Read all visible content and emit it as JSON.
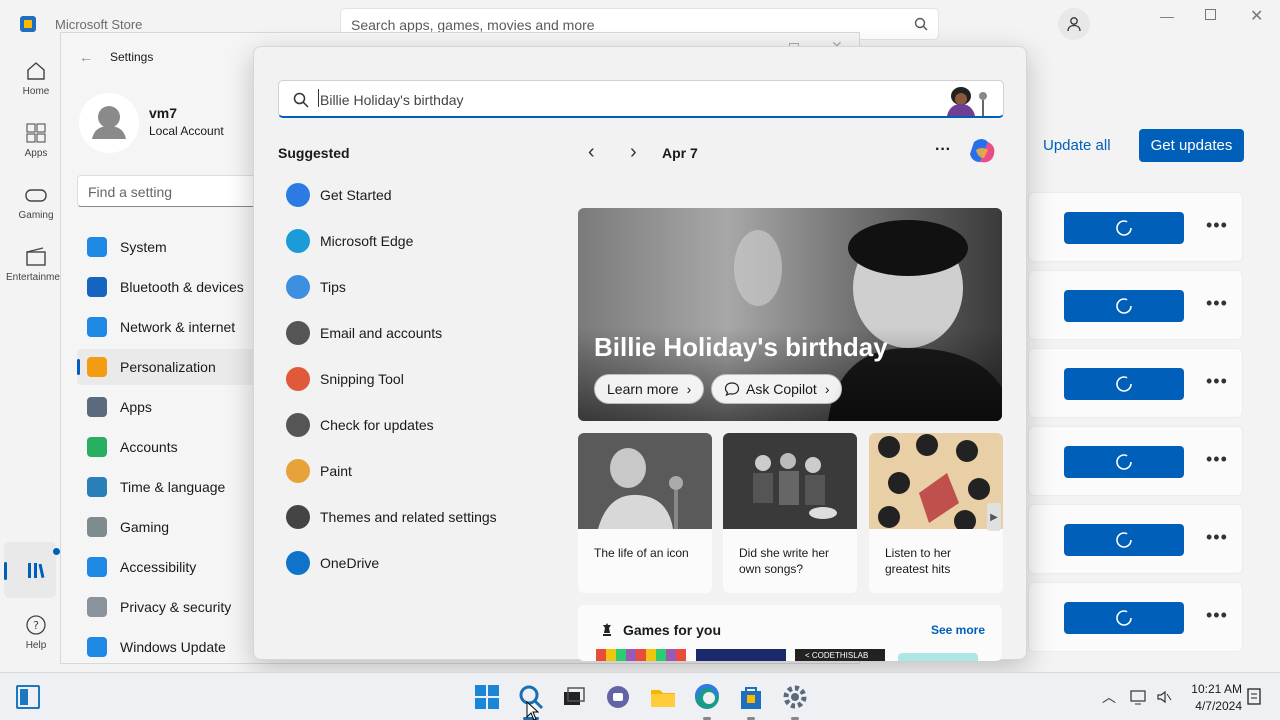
{
  "store": {
    "app_title": "Microsoft Store",
    "search_placeholder": "Search apps, games, movies and more",
    "nav": [
      {
        "label": "Home",
        "icon": "home-icon"
      },
      {
        "label": "Apps",
        "icon": "apps-icon"
      },
      {
        "label": "Gaming",
        "icon": "gaming-icon"
      },
      {
        "label": "Entertainment",
        "icon": "entertainment-icon"
      },
      {
        "label": "Help",
        "icon": "help-icon"
      }
    ],
    "update_all_label": "Update all",
    "get_updates_label": "Get updates",
    "rows_count": 6
  },
  "settings": {
    "title": "Settings",
    "user_name": "vm7",
    "account_type": "Local Account",
    "find_placeholder": "Find a setting",
    "items": [
      {
        "label": "System",
        "color": "#1e88e5"
      },
      {
        "label": "Bluetooth & devices",
        "color": "#1565c0"
      },
      {
        "label": "Network & internet",
        "color": "#1e88e5"
      },
      {
        "label": "Personalization",
        "color": "#f39c12"
      },
      {
        "label": "Apps",
        "color": "#5b6b7d"
      },
      {
        "label": "Accounts",
        "color": "#27ae60"
      },
      {
        "label": "Time & language",
        "color": "#2980b9"
      },
      {
        "label": "Gaming",
        "color": "#7f8c8d"
      },
      {
        "label": "Accessibility",
        "color": "#1e88e5"
      },
      {
        "label": "Privacy & security",
        "color": "#8a939c"
      },
      {
        "label": "Windows Update",
        "color": "#1e88e5"
      }
    ],
    "selected": "Personalization"
  },
  "flyout": {
    "search_value": "Billie Holiday's birthday",
    "suggested_heading": "Suggested",
    "suggestions": [
      {
        "label": "Get Started",
        "icon": "get-started-icon"
      },
      {
        "label": "Microsoft Edge",
        "icon": "edge-icon"
      },
      {
        "label": "Tips",
        "icon": "tips-icon"
      },
      {
        "label": "Email and accounts",
        "icon": "email-icon"
      },
      {
        "label": "Snipping Tool",
        "icon": "snipping-tool-icon"
      },
      {
        "label": "Check for updates",
        "icon": "refresh-icon"
      },
      {
        "label": "Paint",
        "icon": "paint-icon"
      },
      {
        "label": "Themes and related settings",
        "icon": "brush-icon"
      },
      {
        "label": "OneDrive",
        "icon": "onedrive-icon"
      }
    ],
    "date": "Apr 7",
    "hero_title": "Billie Holiday's birthday",
    "learn_more": "Learn more",
    "ask_copilot": "Ask Copilot",
    "tiles": [
      {
        "caption": "The life of an icon"
      },
      {
        "caption": "Did she write her own songs?"
      },
      {
        "caption": "Listen to her greatest hits"
      }
    ],
    "games_heading": "Games for you",
    "see_more": "See more",
    "game_banner_text": "< CODETHISLAB"
  },
  "taskbar": {
    "time": "10:21 AM",
    "date": "4/7/2024"
  },
  "colors": {
    "accent": "#005fb8",
    "flyout_bg": "#f2f2f2"
  }
}
